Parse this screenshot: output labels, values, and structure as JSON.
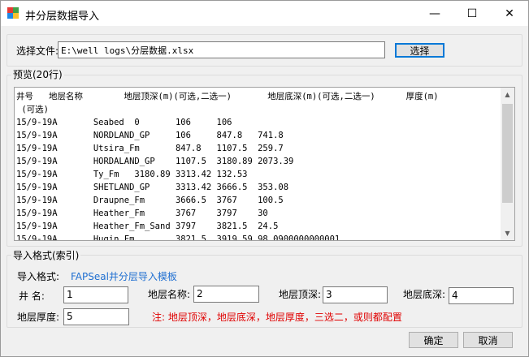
{
  "window": {
    "title": "井分层数据导入",
    "min_glyph": "—",
    "max_glyph": "☐",
    "close_glyph": "✕"
  },
  "file": {
    "label": "选择文件:",
    "path": "E:\\well logs\\分层数据.xlsx",
    "select_button": "选择"
  },
  "preview": {
    "group_title": "预览(20行)",
    "text": "井号   地层名称        地层顶深(m)(可选,二选一)       地层底深(m)(可选,二选一)      厚度(m)\n (可选)\n15/9-19A       Seabed  0       106     106\n15/9-19A       NORDLAND_GP     106     847.8   741.8\n15/9-19A       Utsira_Fm       847.8   1107.5  259.7\n15/9-19A       HORDALAND_GP    1107.5  3180.89 2073.39\n15/9-19A       Ty_Fm   3180.89 3313.42 132.53\n15/9-19A       SHETLAND_GP     3313.42 3666.5  353.08\n15/9-19A       Draupne_Fm      3666.5  3767    100.5\n15/9-19A       Heather_Fm      3767    3797    30\n15/9-19A       Heather_Fm_Sand 3797    3821.5  24.5\n15/9-19A       Hugin_Fm        3821.5  3919.59 98.0900000000001"
  },
  "import": {
    "group_title": "导入格式(索引)",
    "format_label": "导入格式:",
    "template_link": "FAPSeal井分层导入模板",
    "well_name_label": "井    名:",
    "well_name_value": "1",
    "layer_name_label": "地层名称:",
    "layer_name_value": "2",
    "top_depth_label": "地层顶深:",
    "top_depth_value": "3",
    "bottom_depth_label": "地层底深:",
    "bottom_depth_value": "4",
    "thickness_label": "地层厚度:",
    "thickness_value": "5",
    "note": "注: 地层顶深，地层底深，地层厚度，三选二，或则都配置"
  },
  "buttons": {
    "ok": "确定",
    "cancel": "取消"
  },
  "colors": {
    "hint": "#e00000",
    "link": "#1f6fd1",
    "focus": "#0078d7"
  }
}
